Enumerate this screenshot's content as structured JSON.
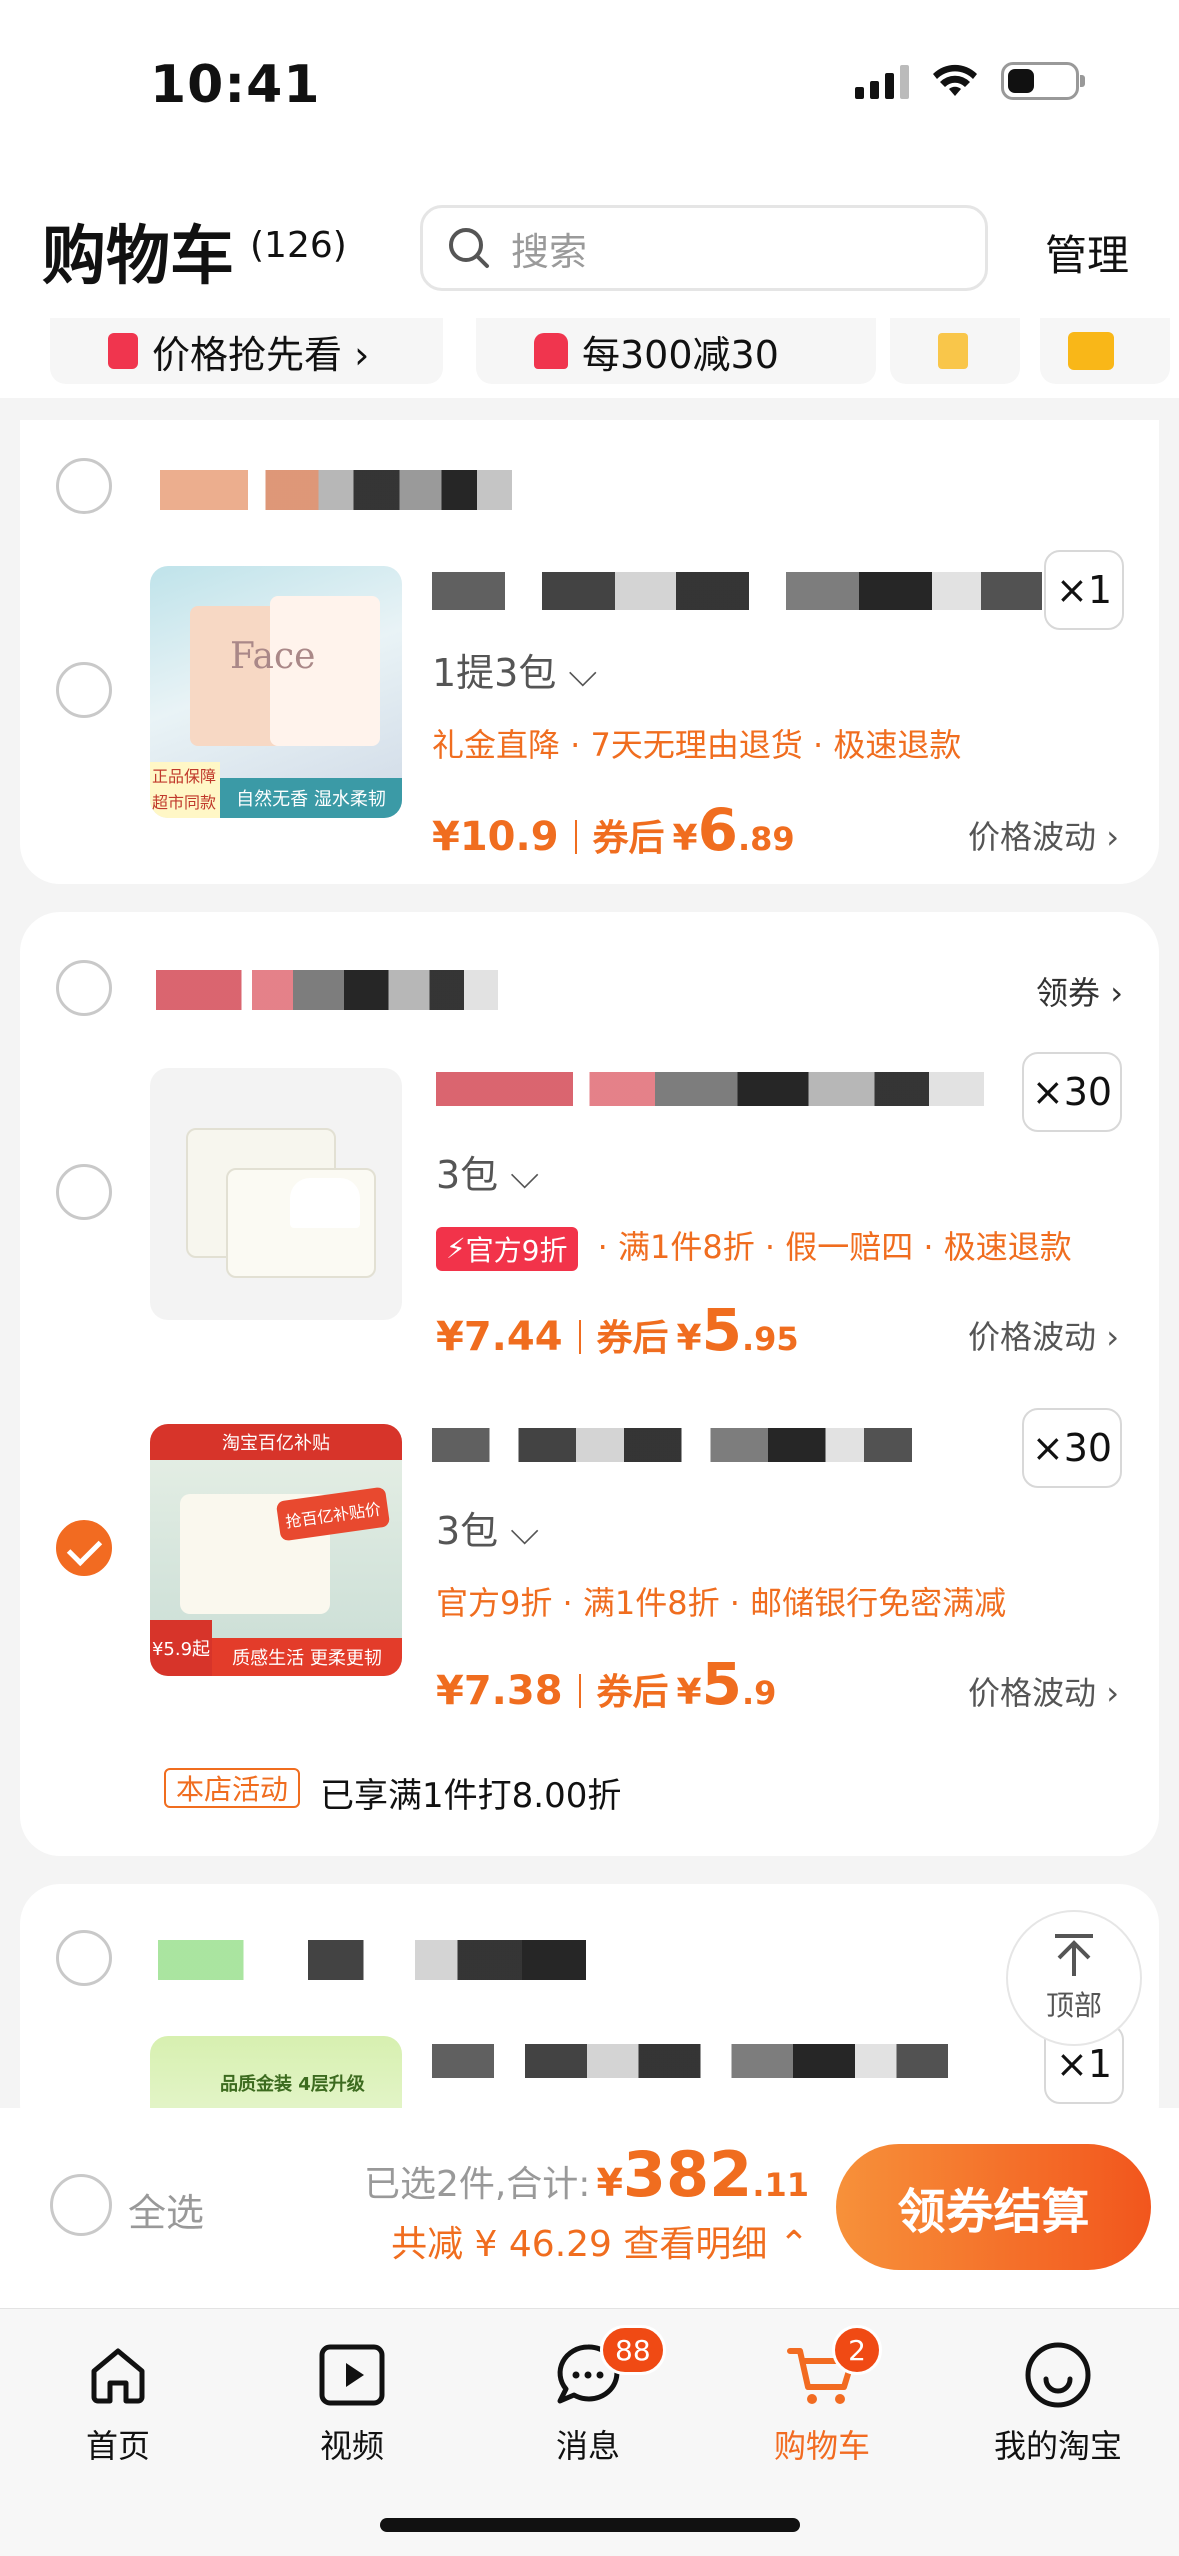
{
  "status": {
    "time": "10:41"
  },
  "header": {
    "title": "购物车",
    "count": "(126)",
    "search_placeholder": "搜索",
    "manage": "管理"
  },
  "promos": [
    {
      "label": "价格抢先看 ›",
      "icon": "price-tag-icon",
      "color": "#f0354e"
    },
    {
      "label": "每300减30",
      "icon": "gift-box-icon",
      "color": "#f0354e"
    }
  ],
  "card1": {
    "spec": "1提3包 ⌵",
    "qty": "×1",
    "tags": "礼金直降 · 7天无理由退货 · 极速退款",
    "price": "¥10.9",
    "after_label": "券后",
    "after_currency": "¥",
    "after_int": "6",
    "after_dec": ".89",
    "wave": "价格波动 ›",
    "thumb_text": {
      "brand": "Face",
      "badge": "正品保障 超市同款",
      "slogan": "自然无香 湿水柔韧"
    }
  },
  "card2": {
    "coupon": "领券 ›",
    "item1": {
      "spec": "3包 ⌵",
      "qty": "×30",
      "flash": "官方9折",
      "tags": " · 满1件8折 · 假一赔四 · 极速退款",
      "price": "¥7.44",
      "after_label": "券后",
      "after_currency": "¥",
      "after_int": "5",
      "after_dec": ".95",
      "wave": "价格波动 ›"
    },
    "item2": {
      "spec": "3包 ⌵",
      "qty": "×30",
      "tags": "官方9折 · 满1件8折 · 邮储银行免密满减",
      "price": "¥7.38",
      "after_label": "券后",
      "after_currency": "¥",
      "after_int": "5",
      "after_dec": ".9",
      "wave": "价格波动 ›",
      "thumb_text": {
        "banner": "淘宝百亿补贴",
        "promo": "抢百亿补贴价",
        "price": "¥5.9起",
        "slogan": "质感生活 更柔更韧"
      }
    },
    "shop_badge": "本店活动",
    "shop_activity": "已享满1件打8.00折"
  },
  "card3": {
    "qty": "×1",
    "thumb_text": "品质金装 4层升级",
    "top_button": "顶部"
  },
  "bottom": {
    "select_all": "全选",
    "selected_prefix": "已选2件,合计:",
    "total_currency": "¥",
    "total_int": "382",
    "total_dec": ".11",
    "saved": "共减 ¥ 46.29  查看明细 ⌃",
    "checkout": "领券结算"
  },
  "tabs": [
    {
      "label": "首页",
      "icon": "home-icon"
    },
    {
      "label": "视频",
      "icon": "video-icon"
    },
    {
      "label": "消息",
      "icon": "message-icon",
      "badge": "88"
    },
    {
      "label": "购物车",
      "icon": "cart-icon",
      "badge": "2",
      "active": true
    },
    {
      "label": "我的淘宝",
      "icon": "profile-icon"
    }
  ],
  "colors": {
    "accent": "#f06d1f",
    "checkout_start": "#f7913a",
    "checkout_end": "#f2561d"
  }
}
